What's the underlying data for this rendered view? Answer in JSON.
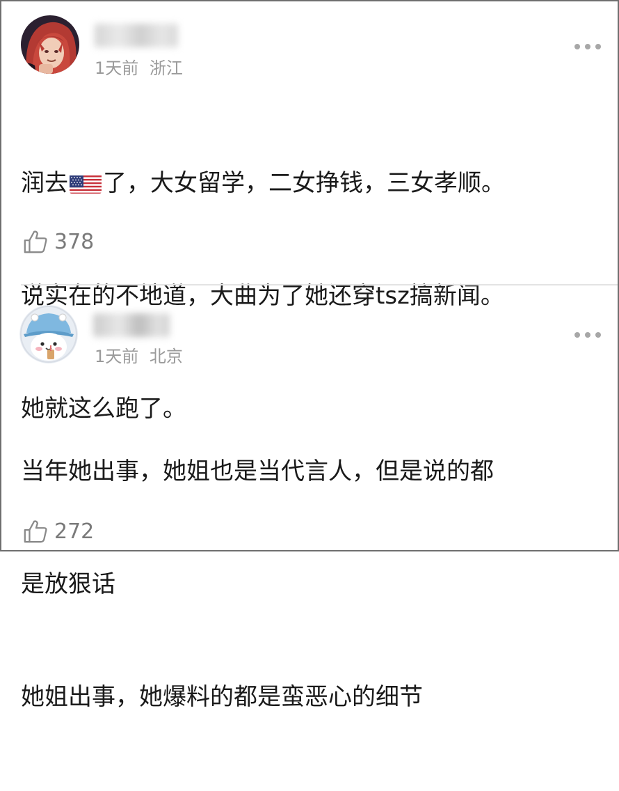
{
  "comments": [
    {
      "time": "1天前",
      "location": "浙江",
      "lines": [
        {
          "before": "润去",
          "after": "了，大女留学，二女挣钱，三女孝顺。"
        },
        "说实在的不地道，大曲为了她还穿tsz搞新闻。",
        "她就这么跑了。"
      ],
      "likes": "378",
      "flag": "us-flag-emoji"
    },
    {
      "time": "1天前",
      "location": "北京",
      "lines": [
        "当年她出事，她姐也是当代言人，但是说的都",
        "是放狠话",
        "她姐出事，她爆料的都是蛮恶心的细节"
      ],
      "likes": "272"
    }
  ],
  "colors": {
    "meta_text": "#9a9a9a",
    "border": "#6f6f6f",
    "divider": "#e3e3e3"
  }
}
